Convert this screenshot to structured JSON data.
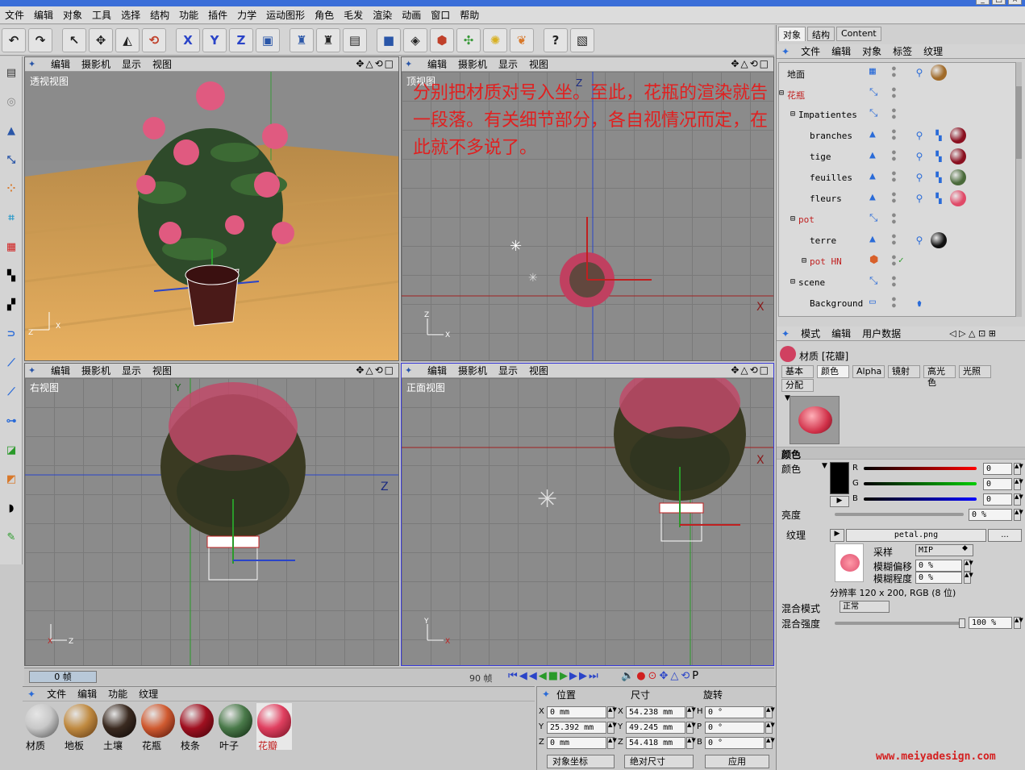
{
  "menubar": [
    "文件",
    "编辑",
    "对象",
    "工具",
    "选择",
    "结构",
    "功能",
    "插件",
    "力学",
    "运动图形",
    "角色",
    "毛发",
    "渲染",
    "动画",
    "窗口",
    "帮助"
  ],
  "toolbar_icons": [
    "undo-icon",
    "redo-icon",
    "select-arrow-icon",
    "move-icon",
    "scale-icon",
    "rotate-icon",
    "x-axis-lock-icon",
    "y-axis-lock-icon",
    "z-axis-lock-icon",
    "coordinate-system-icon",
    "render-view-icon",
    "render-picture-viewer-icon",
    "render-settings-icon",
    "cube-icon",
    "nurbs-icon",
    "deformer-icon",
    "scene-object-icon",
    "light-icon",
    "hair-icon",
    "help-icon",
    "help-book-icon"
  ],
  "toolbar_axis_letters": {
    "x": "X",
    "y": "Y",
    "z": "Z"
  },
  "viewports": [
    {
      "id": "perspective",
      "label": "透视视图",
      "menu": [
        "编辑",
        "摄影机",
        "显示",
        "视图"
      ]
    },
    {
      "id": "top",
      "label": "顶视图",
      "menu": [
        "编辑",
        "摄影机",
        "显示",
        "视图"
      ]
    },
    {
      "id": "right",
      "label": "右视图",
      "menu": [
        "编辑",
        "摄影机",
        "显示",
        "视图"
      ]
    },
    {
      "id": "front",
      "label": "正面视图",
      "menu": [
        "编辑",
        "摄影机",
        "显示",
        "视图"
      ]
    }
  ],
  "annotation_text": "分别把材质对号入坐。至此，花瓶的渲染就告一段落。有关细节部分，各自视情况而定，在此就不多说了。",
  "axis_letters": {
    "x": "X",
    "y": "Y",
    "z": "Z"
  },
  "right_tabs": [
    "对象",
    "结构",
    "Content"
  ],
  "object_menu": [
    "文件",
    "编辑",
    "对象",
    "标签",
    "纹理"
  ],
  "objects": [
    {
      "name": "地面",
      "indent": 0,
      "tags": [
        "tag",
        "wood"
      ]
    },
    {
      "name": "花瓶",
      "indent": 0,
      "expand": "-",
      "tags": []
    },
    {
      "name": "Impatientes",
      "indent": 1,
      "expand": "-",
      "tags": []
    },
    {
      "name": "branches",
      "indent": 2,
      "tags": [
        "tag",
        "uv",
        "darkred"
      ]
    },
    {
      "name": "tige",
      "indent": 2,
      "tags": [
        "tag",
        "uv",
        "darkred"
      ]
    },
    {
      "name": "feuilles",
      "indent": 2,
      "tags": [
        "tag",
        "uv",
        "green"
      ]
    },
    {
      "name": "fleurs",
      "indent": 2,
      "tags": [
        "tag",
        "uv",
        "pink"
      ]
    },
    {
      "name": "pot",
      "indent": 1,
      "expand": "-",
      "tags": []
    },
    {
      "name": "terre",
      "indent": 2,
      "tags": [
        "tag",
        "black"
      ]
    },
    {
      "name": "pot HN",
      "indent": 2,
      "expand": "+",
      "tags": []
    },
    {
      "name": "scene",
      "indent": 1,
      "expand": "-",
      "tags": []
    },
    {
      "name": "Background",
      "indent": 2,
      "tags": [
        "bg"
      ]
    }
  ],
  "attr_menu": [
    "模式",
    "编辑",
    "用户数据"
  ],
  "material_title": "材质 [花瓣]",
  "channel_tabs": [
    "基本",
    "颜色",
    "Alpha",
    "镜射",
    "高光色",
    "光照",
    "分配"
  ],
  "color_section": "颜色",
  "color_label": "颜色",
  "rgb": [
    {
      "ch": "R",
      "value": "0"
    },
    {
      "ch": "G",
      "value": "0"
    },
    {
      "ch": "B",
      "value": "0"
    }
  ],
  "brightness": {
    "label": "亮度",
    "value": "0 %"
  },
  "texture": {
    "label": "纹理",
    "file": "petal.png",
    "more": "...",
    "sampling_label": "采样",
    "sampling": "MIP",
    "blur_offset_label": "模糊偏移",
    "blur_offset": "0 %",
    "blur_scale_label": "模糊程度",
    "blur_scale": "0 %",
    "resolution": "分辨率 120 x 200, RGB (8 位)"
  },
  "mix_mode": {
    "label": "混合模式",
    "value": "正常"
  },
  "mix_strength": {
    "label": "混合强度",
    "value": "100 %",
    "fraction": 1.0
  },
  "timeline": {
    "current": "0 帧",
    "end": "90 帧"
  },
  "material_menu": [
    "文件",
    "编辑",
    "功能",
    "纹理"
  ],
  "materials": [
    {
      "name": "材质",
      "color": "#c8c8c8",
      "dark": "#4a4a4a"
    },
    {
      "name": "地板",
      "color": "#c08a40",
      "dark": "#5a3410"
    },
    {
      "name": "土壤",
      "color": "#3a2a20",
      "dark": "#0a0505"
    },
    {
      "name": "花瓶",
      "color": "#d05a30",
      "dark": "#4a1008"
    },
    {
      "name": "枝条",
      "color": "#a01020",
      "dark": "#3a0208"
    },
    {
      "name": "叶子",
      "color": "#4a7a4a",
      "dark": "#0a200a"
    },
    {
      "name": "花瓣",
      "color": "#e04060",
      "dark": "#701020",
      "selected": true
    }
  ],
  "coords": {
    "headers": [
      "位置",
      "尺寸",
      "旋转"
    ],
    "rows": [
      {
        "axis": "X",
        "pos": "0 mm",
        "sizeaxis": "X",
        "size": "54.238 mm",
        "rotaxis": "H",
        "rot": "0 °"
      },
      {
        "axis": "Y",
        "pos": "25.392 mm",
        "sizeaxis": "Y",
        "size": "49.245 mm",
        "rotaxis": "P",
        "rot": "0 °"
      },
      {
        "axis": "Z",
        "pos": "0 mm",
        "sizeaxis": "Z",
        "size": "54.418 mm",
        "rotaxis": "B",
        "rot": "0 °"
      }
    ],
    "mode": "对象坐标",
    "size_mode": "绝对尺寸",
    "apply": "应用"
  },
  "watermark": "www.meiyadesign.com",
  "colors": {
    "accent": "#2a6bd8",
    "annotation": "#e02020",
    "watermark": "#d42020"
  }
}
